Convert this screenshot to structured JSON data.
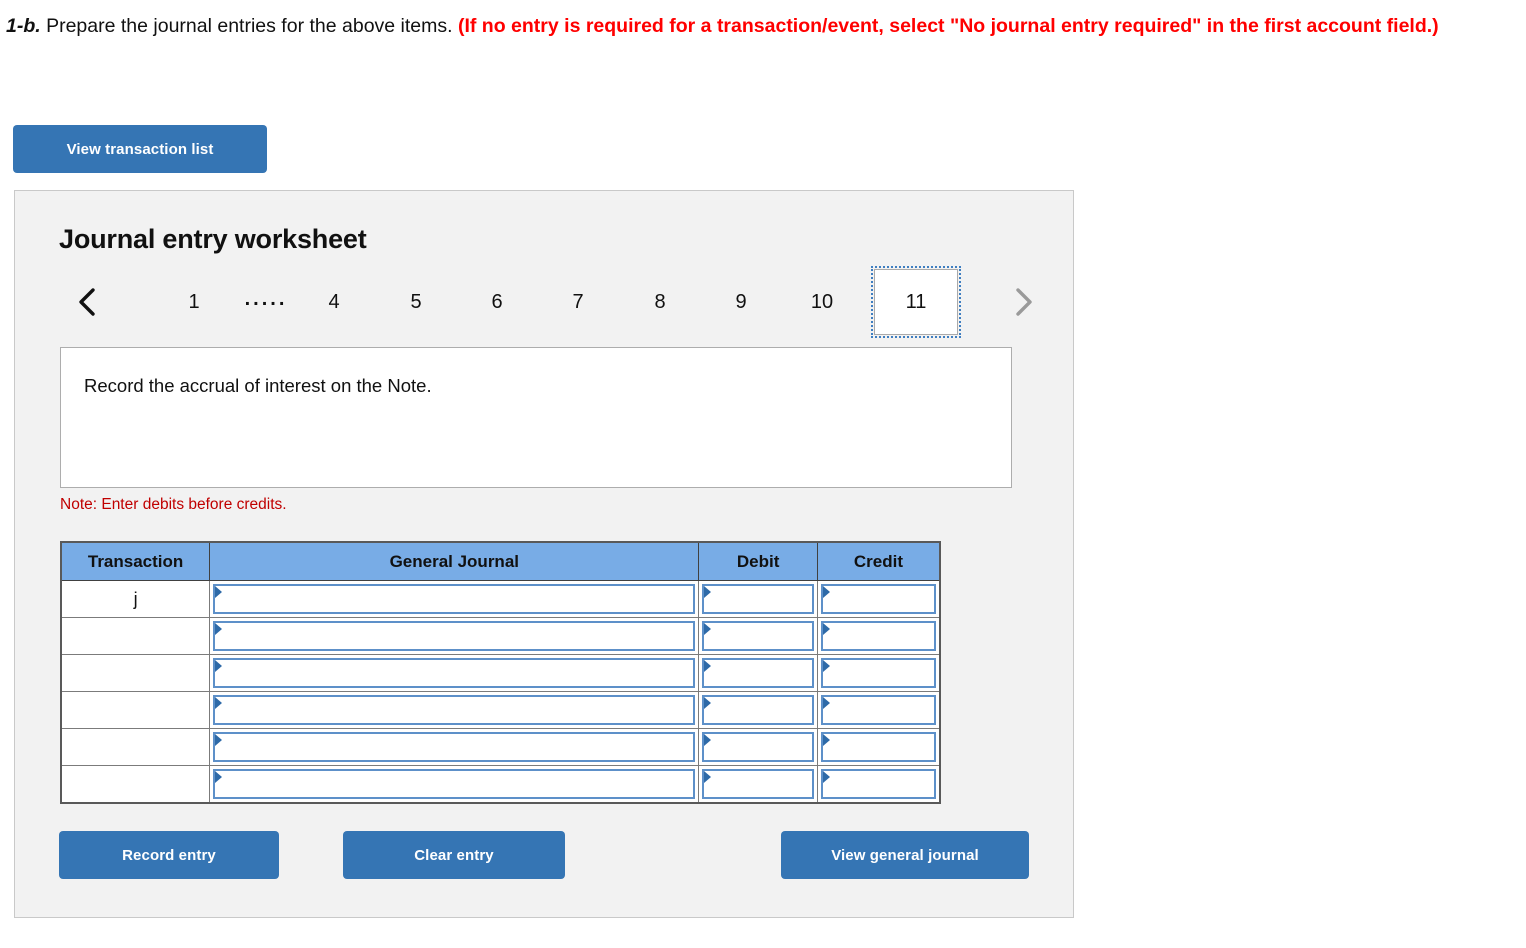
{
  "prompt": {
    "number": "1-b.",
    "text": " Prepare the journal entries for the above items. ",
    "red_note": "(If no entry is required for a transaction/event, select \"No journal entry required\" in the first account field.)"
  },
  "toolbar": {
    "view_transaction_list_label": "View transaction list"
  },
  "worksheet": {
    "title": "Journal entry worksheet",
    "pager": {
      "prev_icon": "chevron-left-icon",
      "next_icon": "chevron-right-icon",
      "items": [
        {
          "label": "1",
          "active": false
        },
        {
          "label": ".....",
          "active": false,
          "ellipsis": true
        },
        {
          "label": "4",
          "active": false
        },
        {
          "label": "5",
          "active": false
        },
        {
          "label": "6",
          "active": false
        },
        {
          "label": "7",
          "active": false
        },
        {
          "label": "8",
          "active": false
        },
        {
          "label": "9",
          "active": false
        },
        {
          "label": "10",
          "active": false
        },
        {
          "label": "11",
          "active": true
        }
      ],
      "active_label": "11"
    },
    "description": "Record the accrual of interest on the Note.",
    "note": "Note: Enter debits before credits.",
    "table": {
      "headers": [
        "Transaction",
        "General Journal",
        "Debit",
        "Credit"
      ],
      "rows": [
        {
          "transaction": "j",
          "general_journal": "",
          "debit": "",
          "credit": ""
        },
        {
          "transaction": "",
          "general_journal": "",
          "debit": "",
          "credit": ""
        },
        {
          "transaction": "",
          "general_journal": "",
          "debit": "",
          "credit": ""
        },
        {
          "transaction": "",
          "general_journal": "",
          "debit": "",
          "credit": ""
        },
        {
          "transaction": "",
          "general_journal": "",
          "debit": "",
          "credit": ""
        },
        {
          "transaction": "",
          "general_journal": "",
          "debit": "",
          "credit": ""
        }
      ]
    },
    "actions": {
      "record_entry_label": "Record entry",
      "clear_entry_label": "Clear entry",
      "view_general_journal_label": "View general journal"
    }
  },
  "colors": {
    "button_blue": "#3575b4",
    "header_blue": "#78ace6",
    "note_red": "#c00000",
    "prompt_red": "#ff0000",
    "panel_bg": "#f2f2f2",
    "input_border_blue": "#5d90c9"
  }
}
